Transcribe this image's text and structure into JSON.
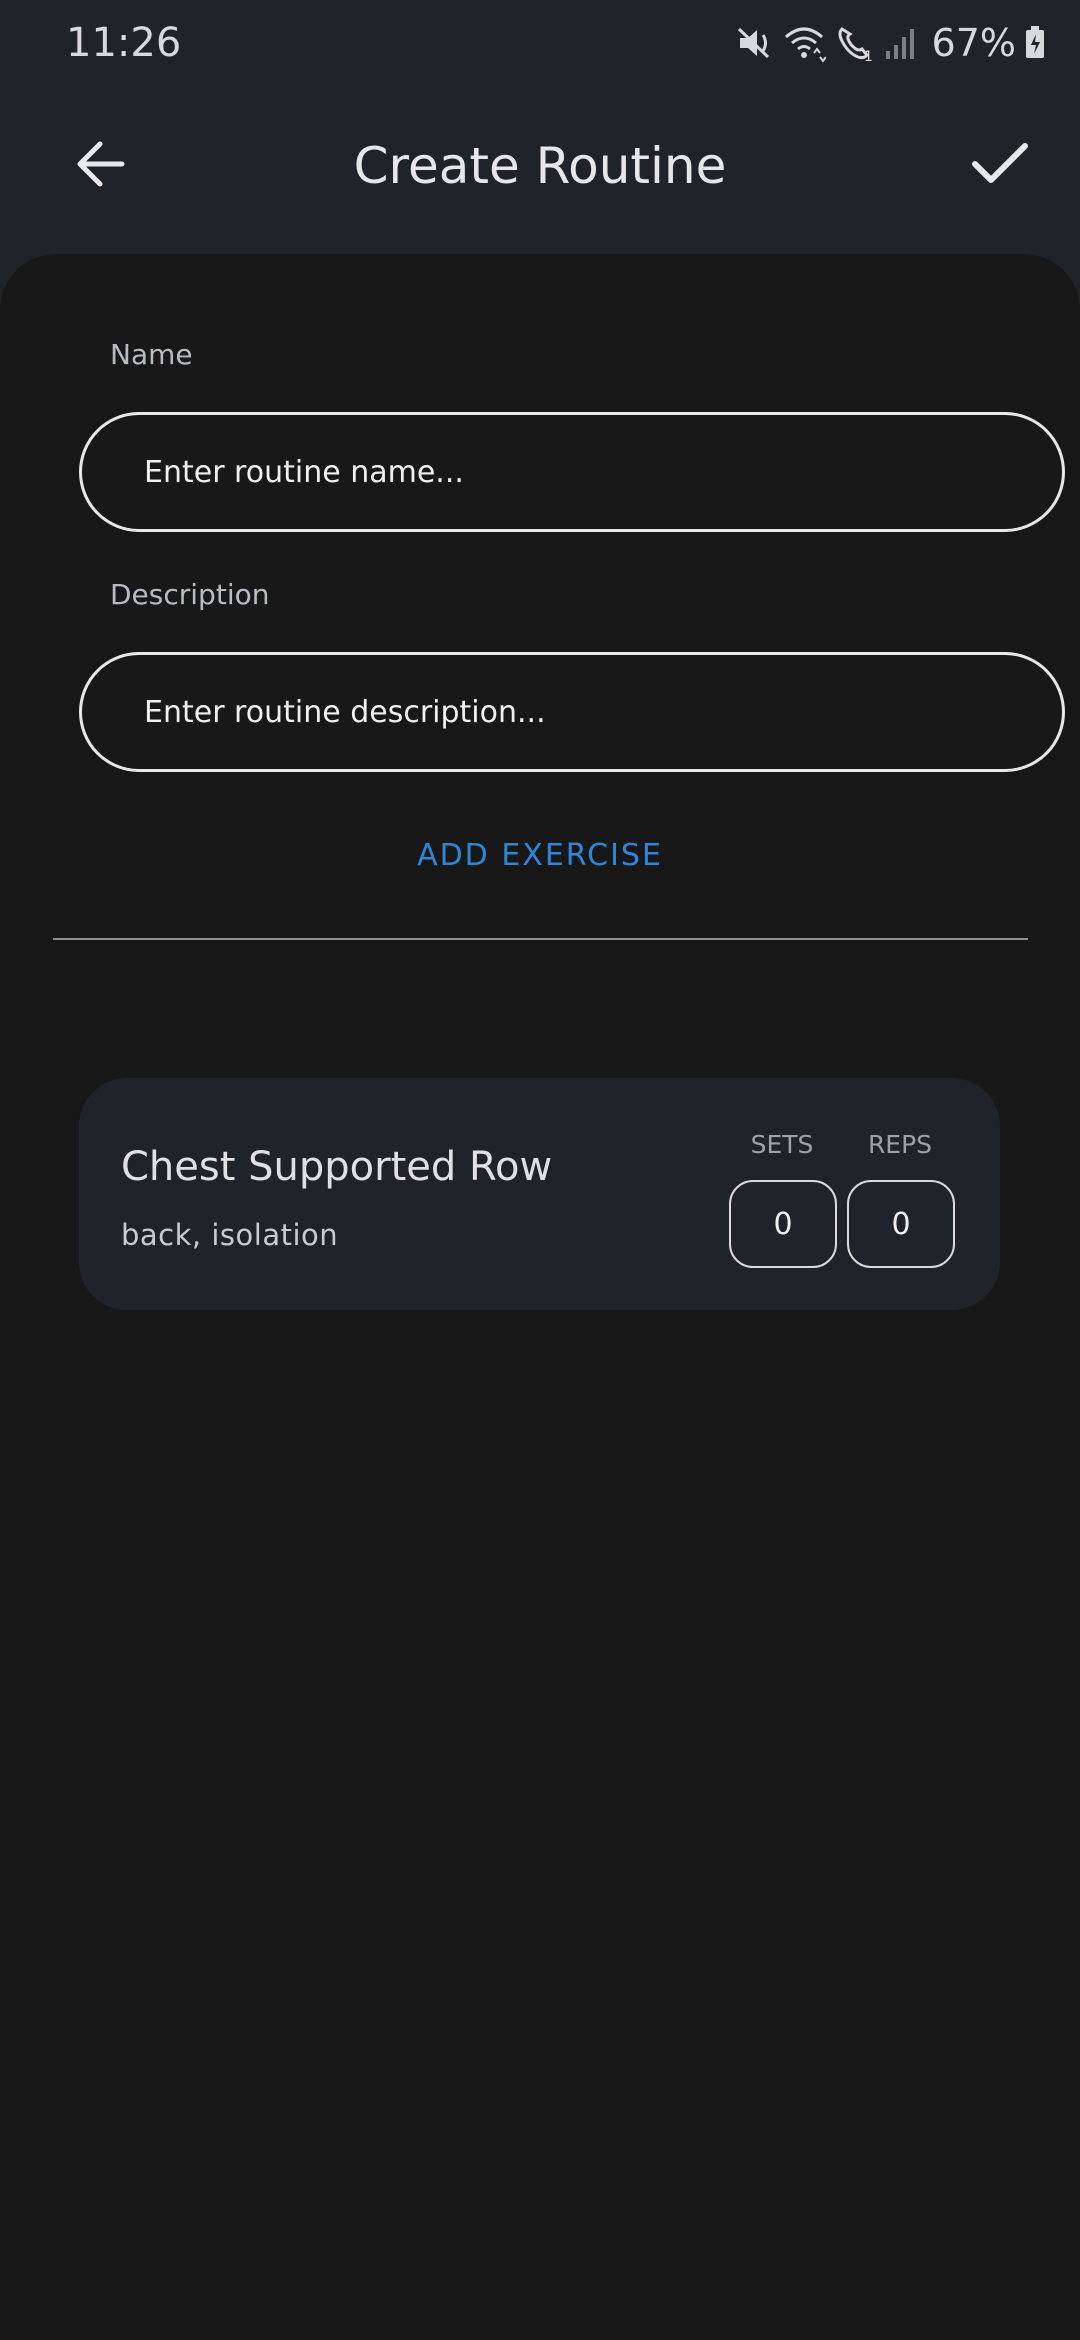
{
  "status_bar": {
    "time": "11:26",
    "battery": "67%",
    "icons": [
      "mute-icon",
      "wifi-icon",
      "call-icon",
      "signal-icon",
      "battery-charging-icon"
    ]
  },
  "app_bar": {
    "title": "Create Routine",
    "back_icon": "arrow-left-icon",
    "confirm_icon": "check-icon"
  },
  "form": {
    "name_label": "Name",
    "name_placeholder": "Enter routine name...",
    "name_value": "",
    "description_label": "Description",
    "description_placeholder": "Enter routine description...",
    "description_value": "",
    "add_exercise_label": "ADD EXERCISE"
  },
  "exercises": [
    {
      "name": "Chest Supported Row",
      "tags": "back, isolation",
      "sets_label": "SETS",
      "reps_label": "REPS",
      "sets": "0",
      "reps": "0"
    }
  ],
  "colors": {
    "header_bg": "#202327",
    "content_bg": "#181818",
    "card_bg": "#202329",
    "accent": "#2d86d7",
    "text_primary": "#e6e7e9"
  }
}
